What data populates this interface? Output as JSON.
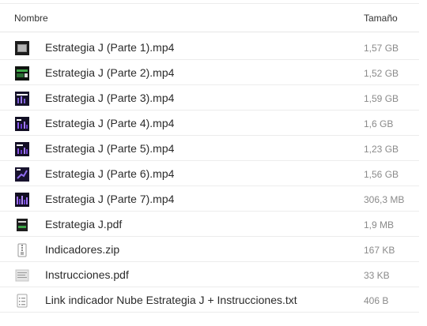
{
  "header": {
    "name_label": "Nombre",
    "size_label": "Tamaño"
  },
  "files": [
    {
      "name": "Estrategia J (Parte 1).mp4",
      "size": "1,57 GB",
      "icon": "video-thumbnail-icon"
    },
    {
      "name": "Estrategia J (Parte 2).mp4",
      "size": "1,52 GB",
      "icon": "video-thumbnail-icon"
    },
    {
      "name": "Estrategia J (Parte 3).mp4",
      "size": "1,59 GB",
      "icon": "video-thumbnail-icon"
    },
    {
      "name": "Estrategia J (Parte 4).mp4",
      "size": "1,6 GB",
      "icon": "video-thumbnail-icon"
    },
    {
      "name": "Estrategia J (Parte 5).mp4",
      "size": "1,23 GB",
      "icon": "video-thumbnail-icon"
    },
    {
      "name": "Estrategia J (Parte 6).mp4",
      "size": "1,56 GB",
      "icon": "video-thumbnail-icon"
    },
    {
      "name": "Estrategia J (Parte 7).mp4",
      "size": "306,3 MB",
      "icon": "video-thumbnail-icon"
    },
    {
      "name": "Estrategia J.pdf",
      "size": "1,9 MB",
      "icon": "pdf-thumbnail-icon"
    },
    {
      "name": "Indicadores.zip",
      "size": "167 KB",
      "icon": "zip-file-icon"
    },
    {
      "name": "Instrucciones.pdf",
      "size": "33 KB",
      "icon": "pdf-thumbnail-icon"
    },
    {
      "name": "Link indicador Nube Estrategia J + Instrucciones.txt",
      "size": "406 B",
      "icon": "text-file-icon"
    }
  ]
}
